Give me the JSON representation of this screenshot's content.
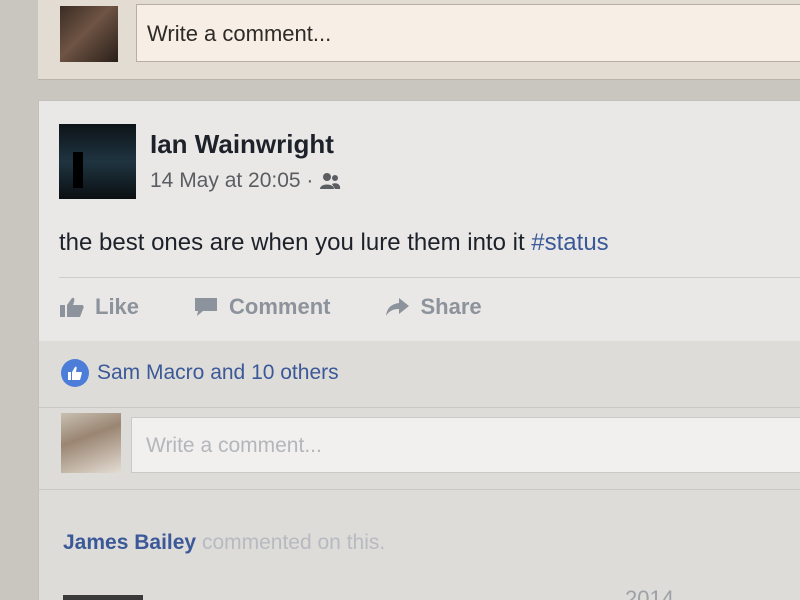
{
  "top_composer": {
    "placeholder": "Write a comment..."
  },
  "post": {
    "author": "Ian Wainwright",
    "timestamp": "14 May at 20:05 ·",
    "audience_icon": "friends-icon",
    "text_main": "the best ones are when you lure them into it ",
    "hashtag": "#status",
    "actions": {
      "like": "Like",
      "comment": "Comment",
      "share": "Share"
    },
    "likes_summary": "Sam Macro and 10 others",
    "comment_placeholder": "Write a comment..."
  },
  "activity": {
    "name": "James Bailey",
    "text": "commented on this."
  },
  "partial_bottom_text": "2014",
  "colors": {
    "link_blue": "#3b5998",
    "action_grey": "#8d939c",
    "like_badge": "#4c7dd8"
  }
}
